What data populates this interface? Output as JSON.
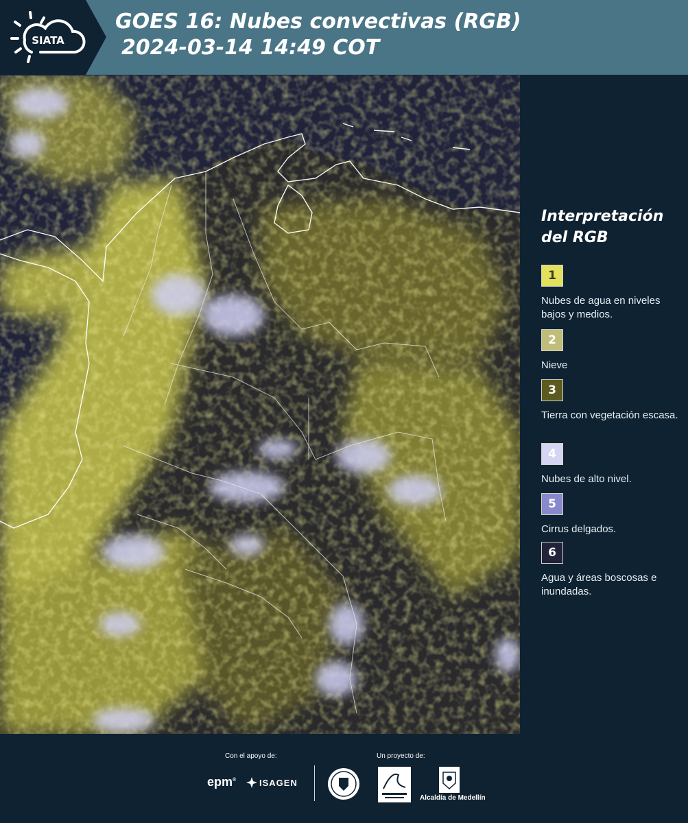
{
  "header": {
    "logo_text": "SIATA",
    "title_line1": "GOES 16: Nubes convectivas (RGB)",
    "title_line2": "2024-03-14 14:49 COT"
  },
  "legend": {
    "title_line1": "Interpretación",
    "title_line2": "del RGB",
    "items": [
      {
        "number": "1",
        "label": "Nubes de agua en niveles bajos y medios.",
        "color": "#e3e05e",
        "text_color": "#3a3a20"
      },
      {
        "number": "2",
        "label": "Nieve",
        "color": "#bfbd78",
        "text_color": "#ffffff"
      },
      {
        "number": "3",
        "label": "Tierra con vegetación escasa.",
        "color": "#5d5a1f",
        "text_color": "#ffffff"
      },
      {
        "number": "4",
        "label": "Nubes de alto nivel.",
        "color": "#d5d5f3",
        "text_color": "#ffffff"
      },
      {
        "number": "5",
        "label": "Cirrus delgados.",
        "color": "#8888cc",
        "text_color": "#ffffff"
      },
      {
        "number": "6",
        "label": "Agua y áreas boscosas e inundadas.",
        "color": "#22223a",
        "text_color": "#ffffff"
      }
    ]
  },
  "footer": {
    "support_label": "Con el apoyo de:",
    "project_label": "Un proyecto de:",
    "epm": "epm",
    "isagen": "ISAGEN",
    "alcaldia": "Alcaldía de Medellín"
  },
  "colors": {
    "header_bg": "#4a7587",
    "dark_bg": "#0f2231",
    "map_water": "#20233a",
    "cloud_low": "#d8d65a",
    "cloud_high": "#c9c9f0"
  }
}
